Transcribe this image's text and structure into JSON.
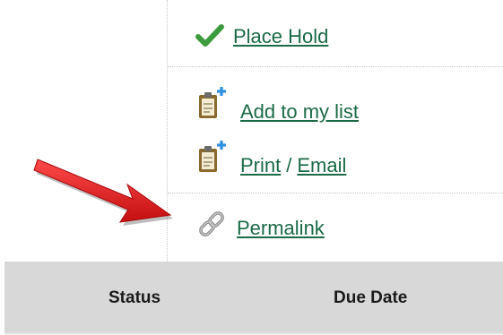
{
  "actions": {
    "place_hold": {
      "label": "Place Hold",
      "icon": "checkmark-icon"
    },
    "add_to_list": {
      "label": "Add to my list",
      "icon": "clipboard-add-icon"
    },
    "print_email": {
      "print_label": "Print",
      "separator": "/",
      "email_label": "Email",
      "icon": "clipboard-add-icon"
    },
    "permalink": {
      "label": "Permalink",
      "icon": "chain-link-icon"
    }
  },
  "table": {
    "headers": [
      "Status",
      "Due Date"
    ]
  },
  "colors": {
    "link": "#1b6b46",
    "header_bg": "#d8d8d8",
    "check_green": "#3c9b3c",
    "plus_blue": "#2f8fe0",
    "arrow_red": "#e0161b"
  }
}
